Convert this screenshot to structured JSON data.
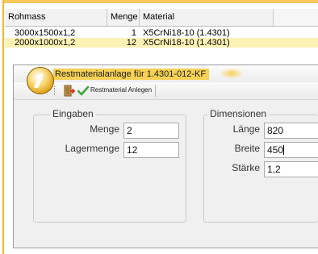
{
  "grid": {
    "columns": [
      "Rohmass",
      "Menge",
      "Material"
    ],
    "rows": [
      {
        "rohmass": "3000x1500x1,2",
        "menge": "1",
        "material": "X5CrNi18-10 (1.4301)"
      },
      {
        "rohmass": "2000x1000x1,2",
        "menge": "12",
        "material": "X5CrNi18-10 (1.4301)"
      }
    ]
  },
  "dialog": {
    "title": "Restmaterialanlage für 1.4301-012-KF",
    "toolbar": {
      "anlegen_label": "Restmaterial Anlegen"
    },
    "eingaben": {
      "legend": "Eingaben",
      "menge_label": "Menge",
      "menge_value": "2",
      "lagermenge_label": "Lagermenge",
      "lagermenge_value": "12"
    },
    "dimensionen": {
      "legend": "Dimensionen",
      "laenge_label": "Länge",
      "laenge_value": "820",
      "breite_label": "Breite",
      "breite_value": "450",
      "staerke_label": "Stärke",
      "staerke_value": "1,2"
    }
  },
  "colors": {
    "accent_orange": "#f5b731",
    "selected_row": "#fdf2b5",
    "title_highlight": "#f6d155"
  }
}
